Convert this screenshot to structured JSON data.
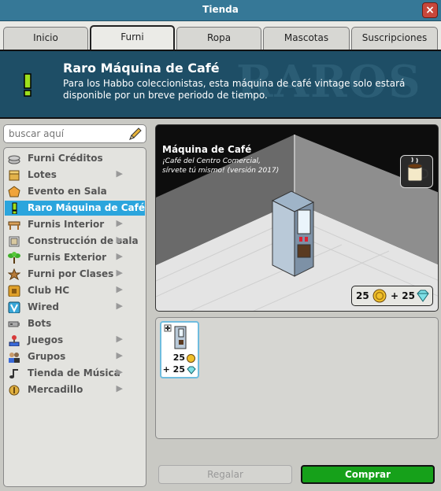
{
  "window": {
    "title": "Tienda",
    "close_glyph": "×"
  },
  "tabs": [
    {
      "label": "Inicio"
    },
    {
      "label": "Furni",
      "active": true
    },
    {
      "label": "Ropa"
    },
    {
      "label": "Mascotas"
    },
    {
      "label": "Suscripciones"
    }
  ],
  "banner": {
    "title": "Raro Máquina de Café",
    "description": "Para los Habbo coleccionistas, esta máquina de café vintage solo estará disponible por un breve periodo de tiempo.",
    "watermark": "RAROS",
    "icon": "exclamation-icon"
  },
  "search": {
    "placeholder": "buscar aquí",
    "value": ""
  },
  "sidebar": {
    "items": [
      {
        "label": "Furni Créditos",
        "icon": "coins-icon",
        "chevron": false
      },
      {
        "label": "Lotes",
        "icon": "bundle-icon",
        "chevron": true
      },
      {
        "label": "Evento en Sala",
        "icon": "event-icon",
        "chevron": false
      },
      {
        "label": "Raro Máquina de Café",
        "icon": "exclamation-icon",
        "chevron": false,
        "active": true
      },
      {
        "label": "Furnis Interior",
        "icon": "table-icon",
        "chevron": true
      },
      {
        "label": "Construcción de sala",
        "icon": "construction-icon",
        "chevron": true
      },
      {
        "label": "Furnis Exterior",
        "icon": "plant-icon",
        "chevron": true
      },
      {
        "label": "Furni por Clases",
        "icon": "star-icon",
        "chevron": true
      },
      {
        "label": "Club HC",
        "icon": "hc-icon",
        "chevron": true
      },
      {
        "label": "Wired",
        "icon": "wired-icon",
        "chevron": true
      },
      {
        "label": "Bots",
        "icon": "bot-icon",
        "chevron": false
      },
      {
        "label": "Juegos",
        "icon": "joystick-icon",
        "chevron": true
      },
      {
        "label": "Grupos",
        "icon": "groups-icon",
        "chevron": true
      },
      {
        "label": "Tienda de Música",
        "icon": "music-note-icon",
        "chevron": true
      },
      {
        "label": "Mercadillo",
        "icon": "market-icon",
        "chevron": true
      }
    ],
    "chevron_glyph": "▶"
  },
  "preview": {
    "title": "Máquina de Café",
    "description": "¡Café del Centro Comercial, sírvete tú mismo! (versión 2017)",
    "price": {
      "credits": "25",
      "plus": "+ 25"
    }
  },
  "grid": {
    "items": [
      {
        "credits": "25",
        "diamonds_line": "+ 25",
        "selected": true
      }
    ]
  },
  "actions": {
    "gift_label": "Regalar",
    "buy_label": "Comprar"
  },
  "colors": {
    "titlebar": "#367897",
    "banner": "#1e4e66",
    "active_item": "#2ba5dd",
    "buy": "#16a11a"
  }
}
